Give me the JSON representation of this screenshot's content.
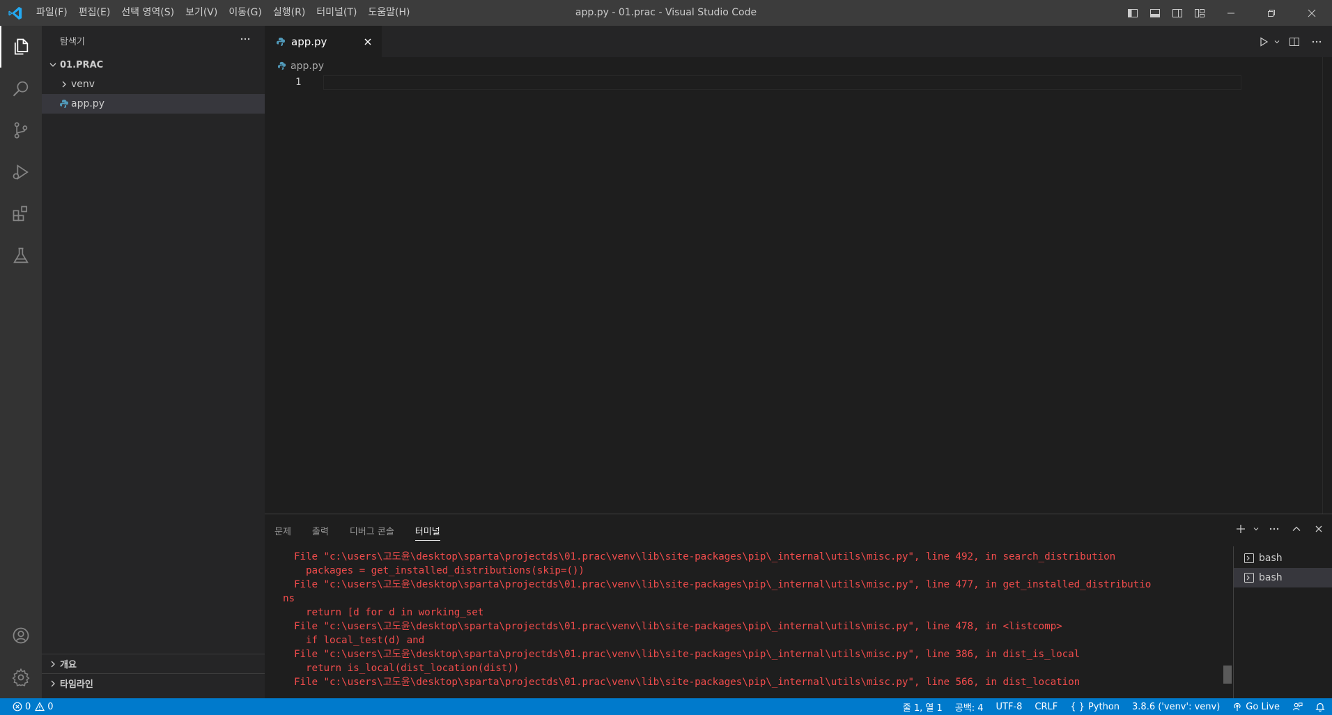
{
  "app": {
    "window_title": "app.py - 01.prac - Visual Studio Code"
  },
  "menu": [
    "파일(F)",
    "편집(E)",
    "선택 영역(S)",
    "보기(V)",
    "이동(G)",
    "실행(R)",
    "터미널(T)",
    "도움말(H)"
  ],
  "sidebar": {
    "title": "탐색기",
    "folder": "01.PRAC",
    "items": [
      {
        "label": "venv",
        "type": "folder"
      },
      {
        "label": "app.py",
        "type": "python-file"
      }
    ],
    "sections": [
      "개요",
      "타임라인"
    ]
  },
  "editor": {
    "tab_label": "app.py",
    "breadcrumb": "app.py",
    "line_number": "1"
  },
  "panel": {
    "tabs": [
      "문제",
      "출력",
      "디버그 콘솔",
      "터미널"
    ],
    "active_tab": "터미널",
    "terminal_lines": [
      "File \"c:\\users\\고도윤\\desktop\\sparta\\projectds\\01.prac\\venv\\lib\\site-packages\\pip\\_internal\\utils\\misc.py\", line 492, in search_distribution",
      "  packages = get_installed_distributions(skip=())",
      "File \"c:\\users\\고도윤\\desktop\\sparta\\projectds\\01.prac\\venv\\lib\\site-packages\\pip\\_internal\\utils\\misc.py\", line 477, in get_installed_distributio",
      "ns",
      "  return [d for d in working_set",
      "File \"c:\\users\\고도윤\\desktop\\sparta\\projectds\\01.prac\\venv\\lib\\site-packages\\pip\\_internal\\utils\\misc.py\", line 478, in <listcomp>",
      "  if local_test(d) and",
      "File \"c:\\users\\고도윤\\desktop\\sparta\\projectds\\01.prac\\venv\\lib\\site-packages\\pip\\_internal\\utils\\misc.py\", line 386, in dist_is_local",
      "  return is_local(dist_location(dist))",
      "File \"c:\\users\\고도윤\\desktop\\sparta\\projectds\\01.prac\\venv\\lib\\site-packages\\pip\\_internal\\utils\\misc.py\", line 566, in dist_location"
    ],
    "terminals": [
      "bash",
      "bash"
    ]
  },
  "statusbar": {
    "errors": "0",
    "warnings": "0",
    "position": "줄 1, 열 1",
    "spaces": "공백: 4",
    "encoding": "UTF-8",
    "eol": "CRLF",
    "language": "Python",
    "interpreter": "3.8.6 ('venv': venv)",
    "go_live": "Go Live"
  },
  "colors": {
    "accent": "#007acc",
    "terminal_error": "#f14c4c",
    "python_icon": "#519aba"
  }
}
